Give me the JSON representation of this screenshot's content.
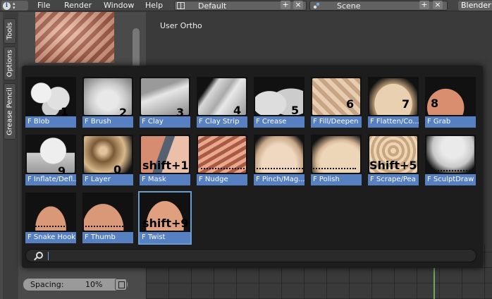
{
  "menubar": {
    "items": [
      "File",
      "Render",
      "Window",
      "Help"
    ],
    "layout_value": "Default",
    "scene_value": "Scene",
    "engine_value": "Blender"
  },
  "shelf": {
    "tabs": [
      "Tools",
      "Options",
      "Grease Pencil"
    ],
    "spacing_label": "Spacing:",
    "spacing_value": "10%"
  },
  "viewport": {
    "label": "User Ortho"
  },
  "brushes": [
    {
      "label": "F Blob",
      "shortcut": "1"
    },
    {
      "label": "F Brush",
      "shortcut": "2"
    },
    {
      "label": "F Clay",
      "shortcut": "3"
    },
    {
      "label": "F Clay Strip",
      "shortcut": "4"
    },
    {
      "label": "F Crease",
      "shortcut": "5"
    },
    {
      "label": "F Fill/Deepen",
      "shortcut": "6"
    },
    {
      "label": "F Flatten/Co...",
      "shortcut": "7"
    },
    {
      "label": "F Grab",
      "shortcut": "8"
    },
    {
      "label": "F Inflate/Defl...",
      "shortcut": "9"
    },
    {
      "label": "F Layer",
      "shortcut": "0"
    },
    {
      "label": "F Mask",
      "shortcut": "shift+1"
    },
    {
      "label": "F Nudge",
      "shortcut": ""
    },
    {
      "label": "F Pinch/Mag...",
      "shortcut": ""
    },
    {
      "label": "F Polish",
      "shortcut": ""
    },
    {
      "label": "F Scrape/Pea",
      "shortcut": "Shift+5"
    },
    {
      "label": "F SculptDraw",
      "shortcut": ""
    },
    {
      "label": "F Snake Hook",
      "shortcut": ""
    },
    {
      "label": "F Thumb",
      "shortcut": ""
    },
    {
      "label": "F Twist",
      "shortcut": "shift+9"
    }
  ],
  "search": {
    "value": ""
  },
  "colors": {
    "label_blue": "#5680c2",
    "selection_outline": "#6a9cd0"
  }
}
